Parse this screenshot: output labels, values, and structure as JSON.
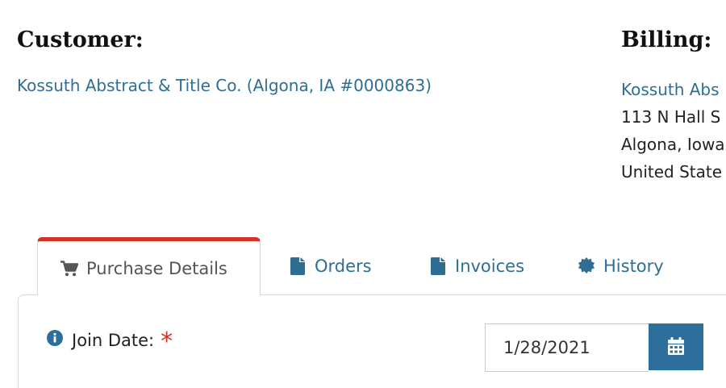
{
  "customer": {
    "heading": "Customer:",
    "link": "Kossuth Abstract & Title Co. (Algona, IA #0000863)"
  },
  "billing": {
    "heading": "Billing:",
    "name_link": "Kossuth Abs",
    "address_line1": "113 N Hall S",
    "address_line2": "Algona, Iowa",
    "address_line3": "United State"
  },
  "tabs": [
    {
      "label": "Purchase Details",
      "icon": "shopping-cart-icon",
      "active": true
    },
    {
      "label": "Orders",
      "icon": "file-icon",
      "active": false
    },
    {
      "label": "Invoices",
      "icon": "file-icon",
      "active": false
    },
    {
      "label": "History",
      "icon": "certificate-icon",
      "active": false
    }
  ],
  "form": {
    "join_date_label": "Join Date:",
    "join_date_info_icon": "info-circle-icon",
    "required_marker": "*",
    "join_date_value": "1/28/2021",
    "calendar_button_icon": "calendar-icon"
  },
  "colors": {
    "link": "#2e6e93",
    "active_tab_border": "#d33327",
    "button_bg": "#2e6e9c",
    "required": "#d33327"
  }
}
